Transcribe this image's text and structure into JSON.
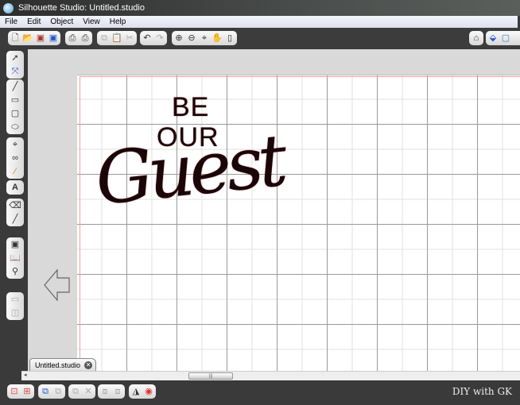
{
  "window": {
    "title": "Silhouette Studio: Untitled.studio"
  },
  "menu": [
    "File",
    "Edit",
    "Object",
    "View",
    "Help"
  ],
  "design": {
    "line1": "BE",
    "line2": "OUR",
    "line3": "Guest"
  },
  "document_tab": {
    "label": "Untitled.studio",
    "close": "✕"
  },
  "watermark": "DIY with GK",
  "colors": {
    "accent_margin": "#f4a0a0",
    "design_outline": "#8a0010",
    "toolbar_bg": "#3a3a3a"
  }
}
